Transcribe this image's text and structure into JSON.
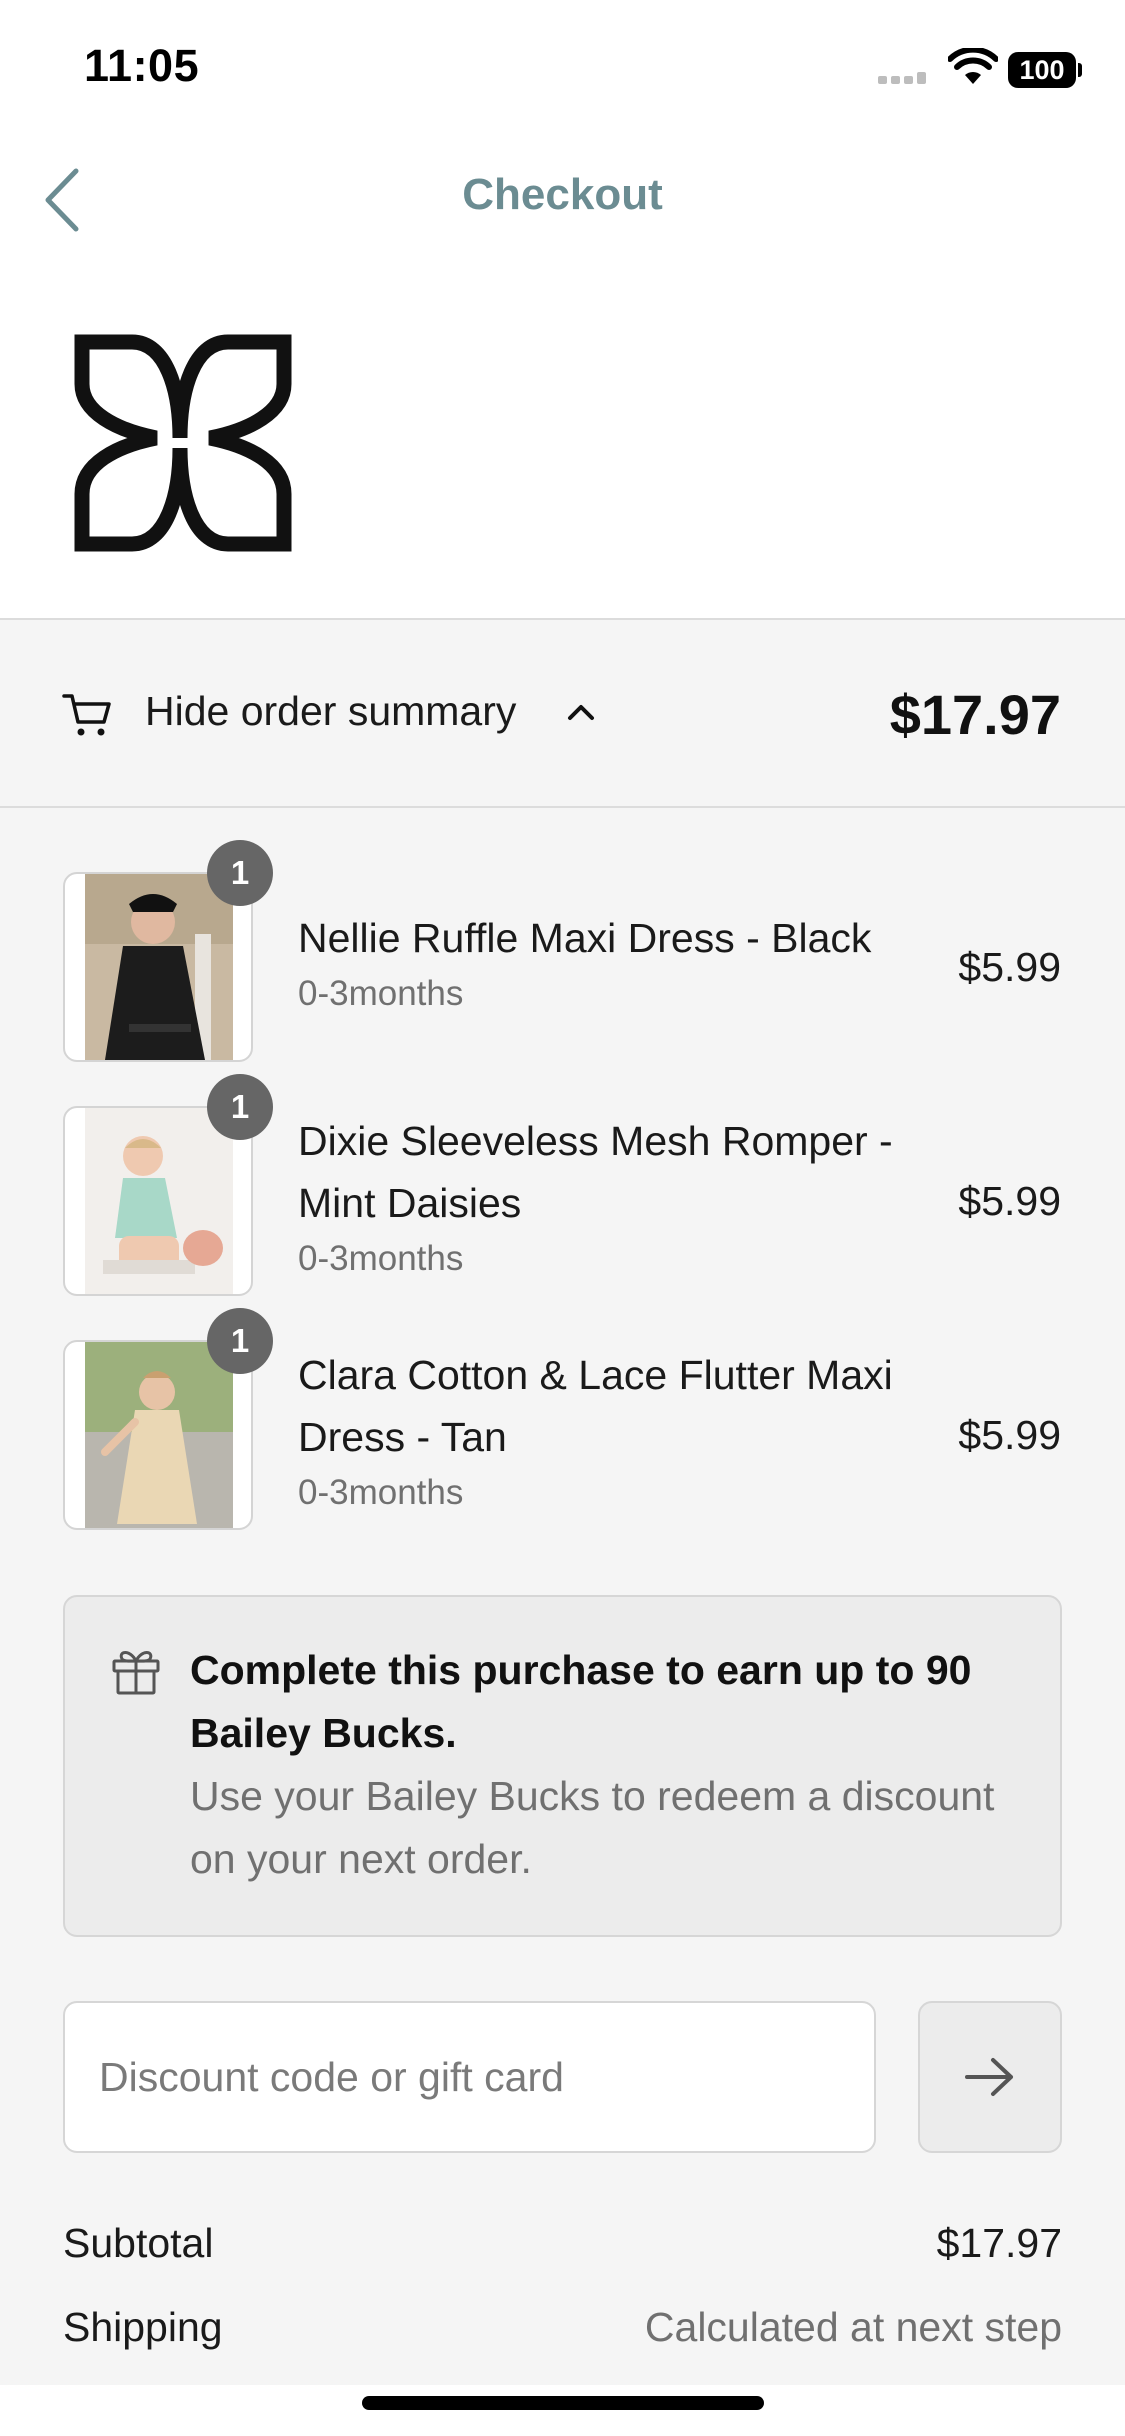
{
  "status_bar": {
    "time": "11:05",
    "battery": "100"
  },
  "nav": {
    "title": "Checkout"
  },
  "summary": {
    "toggle_label": "Hide order summary",
    "total": "$17.97"
  },
  "items": [
    {
      "quantity": "1",
      "name": "Nellie Ruffle Maxi Dress - Black",
      "variant": "0-3months",
      "price": "$5.99"
    },
    {
      "quantity": "1",
      "name": "Dixie Sleeveless Mesh Romper - Mint Daisies",
      "variant": "0-3months",
      "price": "$5.99"
    },
    {
      "quantity": "1",
      "name": "Clara Cotton & Lace Flutter Maxi Dress - Tan",
      "variant": "0-3months",
      "price": "$5.99"
    }
  ],
  "rewards": {
    "title": "Complete this purchase to earn up to 90 Bailey Bucks.",
    "body": "Use your Bailey Bucks to redeem a discount on your next order."
  },
  "discount": {
    "placeholder": "Discount code or gift card"
  },
  "totals": {
    "subtotal_label": "Subtotal",
    "subtotal_value": "$17.97",
    "shipping_label": "Shipping",
    "shipping_value": "Calculated at next step"
  },
  "colors": {
    "title_accent": "#6b8c92",
    "panel_background": "#f5f5f5",
    "badge": "#666666",
    "muted_text": "#707070"
  },
  "icons": [
    "back-chevron-icon",
    "cart-icon",
    "chevron-up-icon",
    "gift-icon",
    "arrow-right-icon",
    "brand-logo"
  ]
}
